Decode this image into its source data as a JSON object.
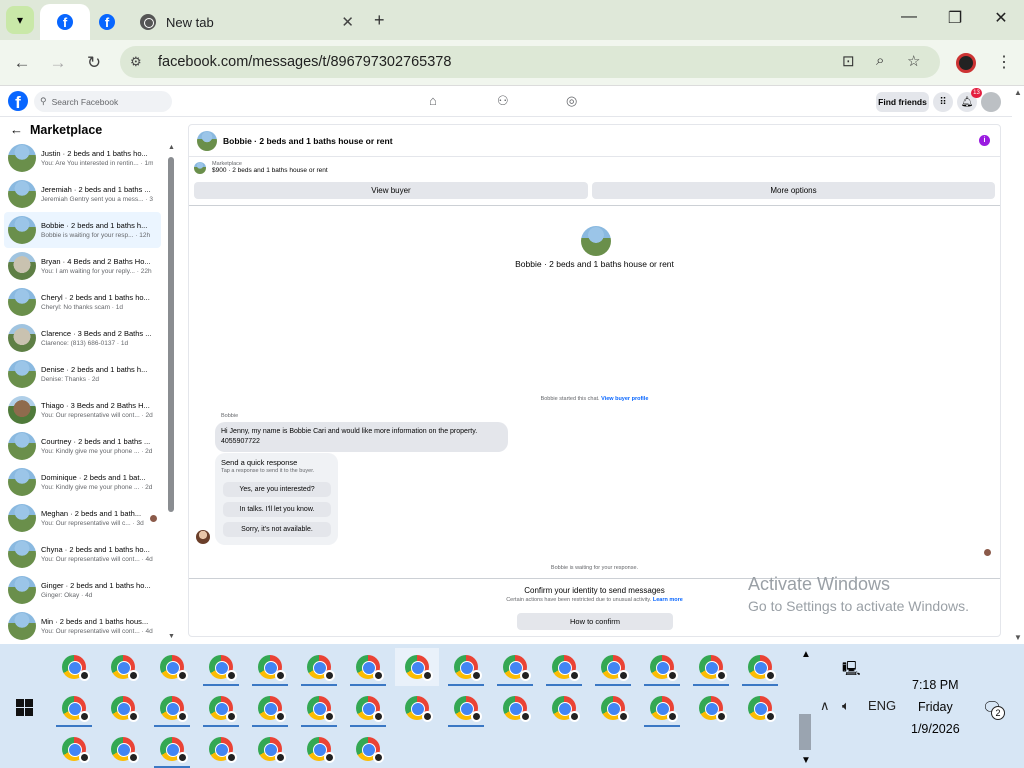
{
  "browser": {
    "tabs": [
      {
        "title": "",
        "favicon": "facebook-icon",
        "active": true
      },
      {
        "title": "",
        "favicon": "facebook-icon",
        "active": false
      },
      {
        "title": "New tab",
        "favicon": "chrome-icon",
        "active": false
      }
    ],
    "url": "facebook.com/messages/t/896797302765378"
  },
  "fb": {
    "search_placeholder": "Search Facebook",
    "find_friends": "Find friends",
    "notification_count": "13"
  },
  "sidebar": {
    "title": "Marketplace",
    "conversations": [
      {
        "name": "Justin · 2 beds and 1 baths ho...",
        "preview": "You: Are You interested in rentin... · 1m",
        "avatar": "house"
      },
      {
        "name": "Jeremiah · 2 beds and 1 baths ...",
        "preview": "Jeremiah Gentry sent you a mess... · 3h",
        "avatar": "house"
      },
      {
        "name": "Bobbie · 2 beds and 1 baths h...",
        "preview": "Bobbie is waiting for your resp... · 12h",
        "avatar": "house",
        "active": true
      },
      {
        "name": "Bryan · 4 Beds and 2 Baths Ho...",
        "preview": "You: I am waiting for your reply... · 22h",
        "avatar": "house2"
      },
      {
        "name": "Cheryl · 2 beds and 1 baths ho...",
        "preview": "Cheryl: No thanks scam · 1d",
        "avatar": "house"
      },
      {
        "name": "Clarence · 3 Beds and 2 Baths ...",
        "preview": "Clarence: (813) 686-0137 · 1d",
        "avatar": "house2"
      },
      {
        "name": "Denise · 2 beds and 1 baths h...",
        "preview": "Denise: Thanks · 2d",
        "avatar": "house"
      },
      {
        "name": "Thiago · 3 Beds and 2 Baths H...",
        "preview": "You: Our representative will cont... · 2d",
        "avatar": "house3"
      },
      {
        "name": "Courtney · 2 beds and 1 baths ...",
        "preview": "You: Kindly give me your phone ... · 2d",
        "avatar": "house"
      },
      {
        "name": "Dominique · 2 beds and 1 bat...",
        "preview": "You: Kindly give me your phone ... · 2d",
        "avatar": "house"
      },
      {
        "name": "Meghan · 2 beds and 1 bath...",
        "preview": "You: Our representative will c... · 3d",
        "avatar": "house",
        "seen": true
      },
      {
        "name": "Chyna · 2 beds and 1 baths ho...",
        "preview": "You: Our representative will cont... · 4d",
        "avatar": "house"
      },
      {
        "name": "Ginger · 2 beds and 1 baths ho...",
        "preview": "Ginger: Okay · 4d",
        "avatar": "house"
      },
      {
        "name": "Min · 2 beds and 1 baths hous...",
        "preview": "You: Our representative will cont... · 4d",
        "avatar": "house"
      }
    ]
  },
  "chat": {
    "title": "Bobbie · 2 beds and 1 baths house or rent",
    "listing_label": "Marketplace",
    "listing_price": "$900 · 2 beds and 1 baths house or rent",
    "view_buyer": "View buyer",
    "more_options": "More options",
    "center_title": "Bobbie · 2 beds and 1 baths house or rent",
    "started_text": "Bobbie started this chat.",
    "started_link": "View buyer profile",
    "sender_name": "Bobbie",
    "message_line1": "Hi Jenny, my name is Bobbie Cari and would like more information on the property.",
    "message_line2": "4055907722",
    "quick_title": "Send a quick response",
    "quick_sub": "Tap a response to send it to the buyer.",
    "quick_responses": [
      "Yes, are you interested?",
      "In talks. I'll let you know.",
      "Sorry, it's not available."
    ],
    "waiting": "Bobbie is waiting for your response.",
    "confirm_title": "Confirm your identity to send messages",
    "confirm_sub": "Certain actions have been restricted due to unusual activity.",
    "confirm_link": "Learn more",
    "confirm_button": "How to confirm"
  },
  "watermark": {
    "title": "Activate Windows",
    "subtitle": "Go to Settings to activate Windows."
  },
  "taskbar": {
    "language": "ENG",
    "time": "7:18 PM",
    "day": "Friday",
    "date": "1/9/2026",
    "notifications": "2",
    "icons_row1": 15,
    "icons_row2": 15,
    "icons_row3": 7
  },
  "colors": {
    "fb_blue": "#0866ff",
    "taskbar_bg": "#d7e6f5",
    "tabstrip_bg": "#dfe8d9"
  }
}
